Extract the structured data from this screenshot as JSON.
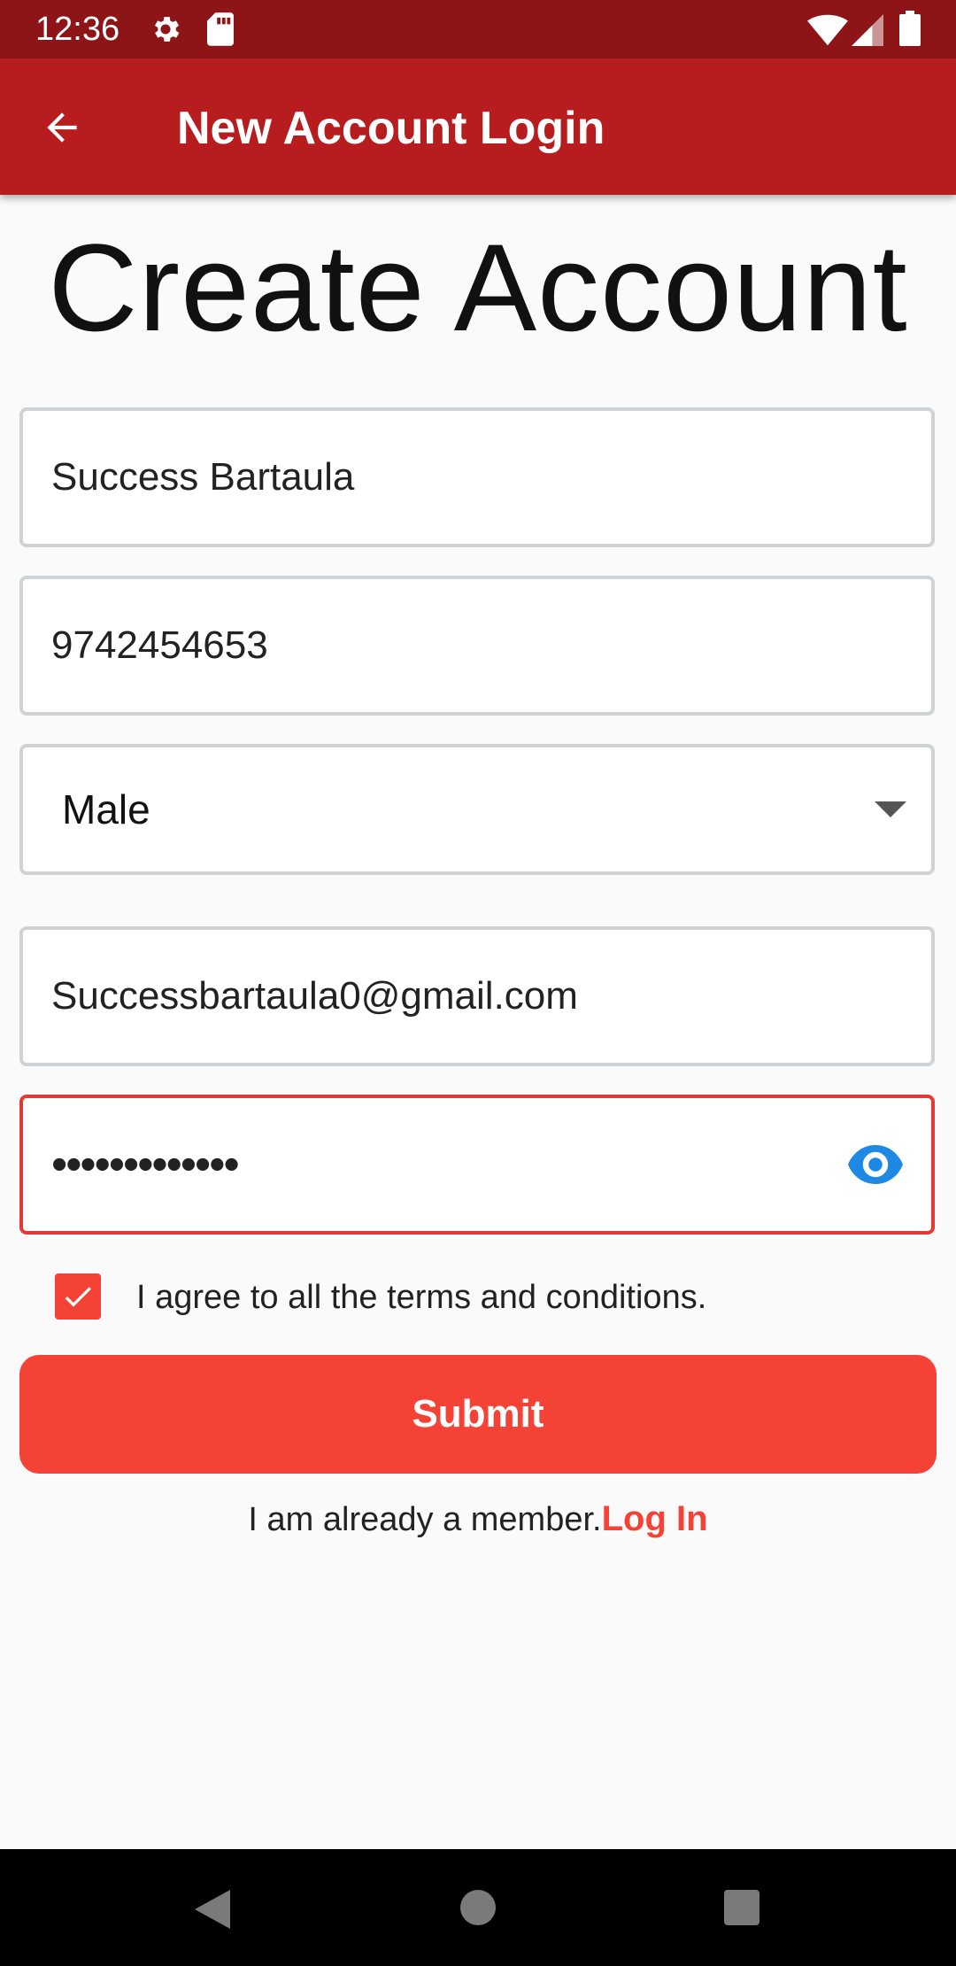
{
  "status_bar": {
    "time": "12:36",
    "icons": [
      "gear-icon",
      "sd-card-icon",
      "wifi-icon",
      "signal-icon",
      "battery-icon"
    ]
  },
  "app_bar": {
    "title": "New Account Login",
    "back_icon": "arrow-left-icon"
  },
  "page": {
    "title": "Create Account"
  },
  "form": {
    "name_value": "Success Bartaula",
    "phone_value": "9742454653",
    "gender_selected": "Male",
    "email_value": "Successbartaula0@gmail.com",
    "password_masked": "•••••••••••••",
    "password_visibility_icon": "eye-icon",
    "terms_label": "I agree to all the terms and conditions.",
    "terms_checked": true,
    "submit_label": "Submit"
  },
  "footer": {
    "member_text": "I am already a member.",
    "login_link": "Log In"
  },
  "colors": {
    "status_bar": "#8d1518",
    "app_bar": "#b71c1f",
    "accent": "#f44336",
    "error_border": "#e53935",
    "eye_icon": "#1e88e5"
  }
}
